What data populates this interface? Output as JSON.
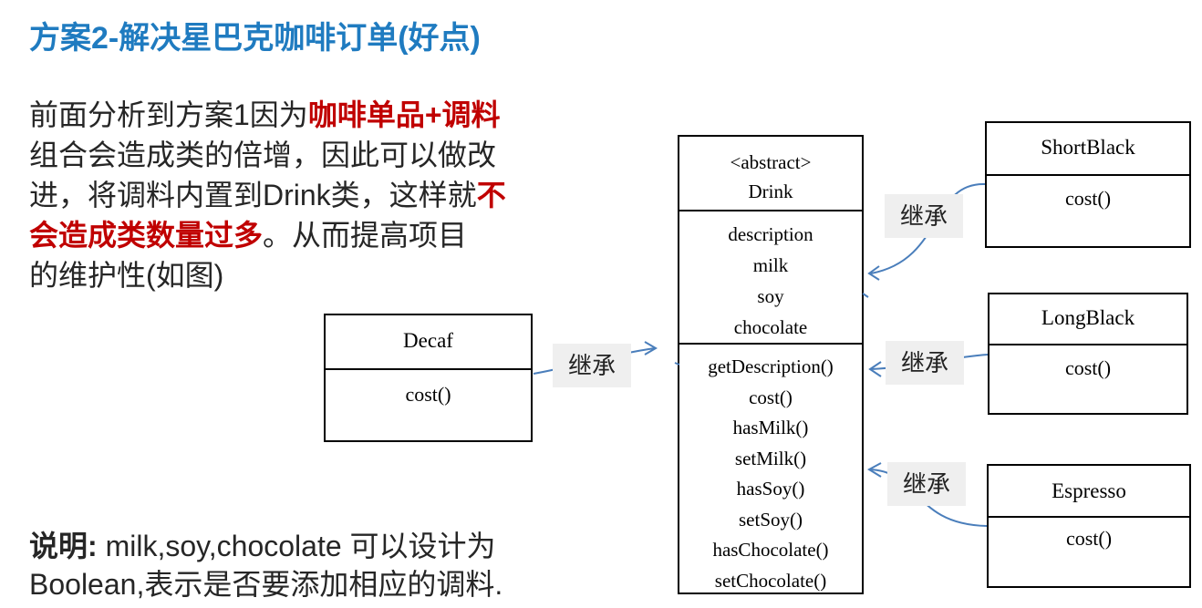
{
  "title": "方案2-解决星巴克咖啡订单(好点)",
  "paragraph": {
    "p1": "前面分析到方案1因为",
    "p1_red": "咖啡单品+调料",
    "p2": "组合会造成类的倍增，因此可以做改",
    "p3": "进，将调料内置到Drink类，这样就",
    "p3_red": "不",
    "p4_red": "会造成类数量过多",
    "p4": "。从而提高项目",
    "p5": "的维护性(如图)"
  },
  "note": {
    "label": "说明:",
    "line1_rest": " milk,soy,chocolate 可以设计为",
    "line2": "Boolean,表示是否要添加相应的调料."
  },
  "drink": {
    "stereotype": "<abstract>",
    "name": "Drink",
    "attributes": [
      "description",
      "milk",
      "soy",
      "chocolate"
    ],
    "methods": [
      "getDescription()",
      "cost()",
      "hasMilk()",
      "setMilk()",
      "hasSoy()",
      "setSoy()",
      "hasChocolate()",
      "setChocolate()"
    ]
  },
  "decaf": {
    "name": "Decaf",
    "method": "cost()"
  },
  "shortblack": {
    "name": "ShortBlack",
    "method": "cost()"
  },
  "longblack": {
    "name": "LongBlack",
    "method": "cost()"
  },
  "espresso": {
    "name": "Espresso",
    "method": "cost()"
  },
  "inherit_label": "继承",
  "colors": {
    "title": "#1f7bc0",
    "highlight": "#c00000",
    "arrow": "#4a7ebb",
    "label_bg": "#efefef"
  }
}
